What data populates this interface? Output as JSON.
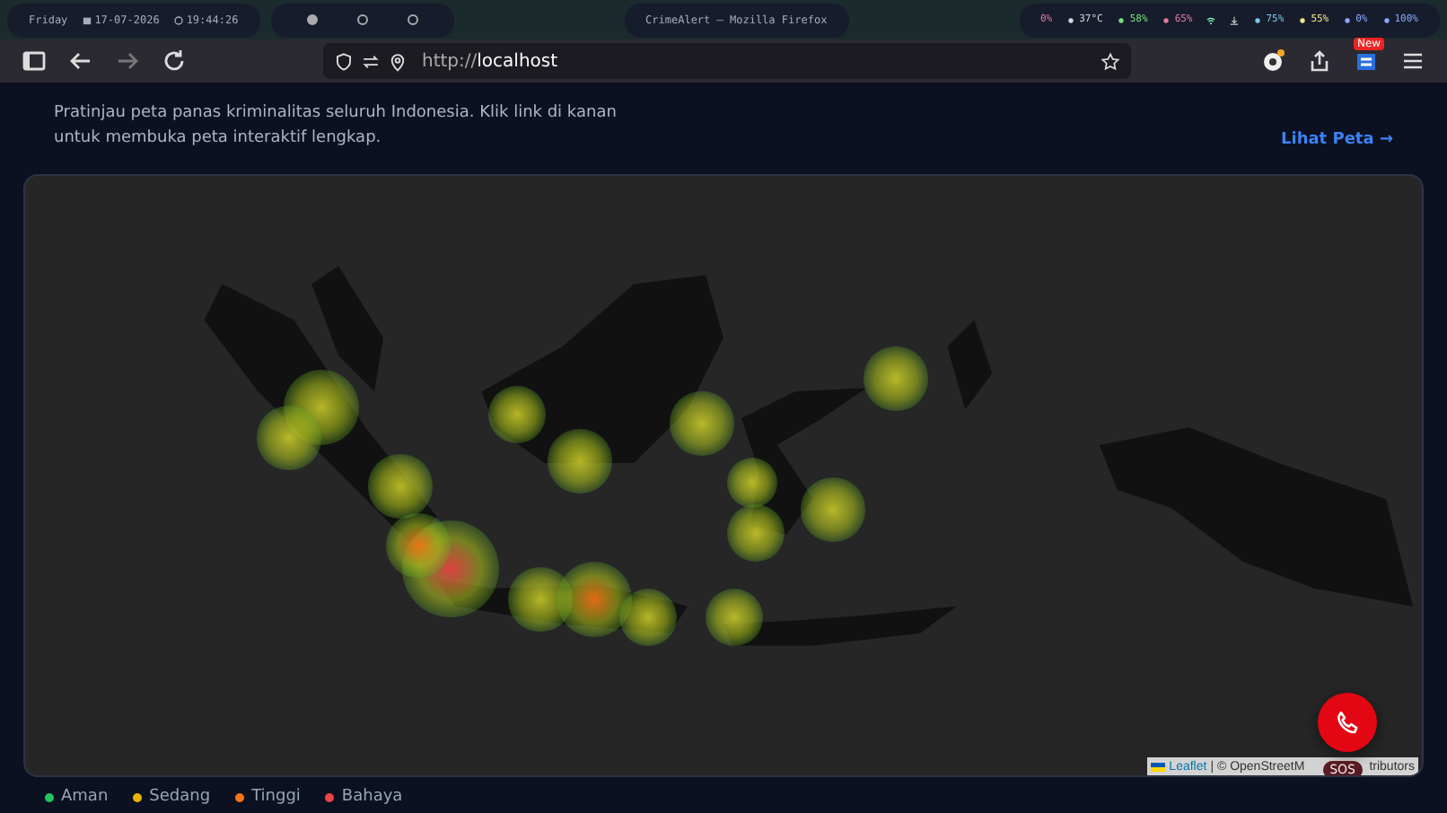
{
  "system_bar": {
    "day": "Friday",
    "date": "17-07-2026",
    "time": "19:44:26",
    "window_title": "CrimeAlert — Mozilla Firefox",
    "stats": [
      {
        "kind": "cpu",
        "value": "0%"
      },
      {
        "kind": "temp",
        "value": "37°C"
      },
      {
        "kind": "memory",
        "value": "58%"
      },
      {
        "kind": "disk",
        "value": "65%"
      },
      {
        "kind": "wifi"
      },
      {
        "kind": "download"
      },
      {
        "kind": "battery",
        "value": "75%"
      },
      {
        "kind": "brightness",
        "value": "55%"
      },
      {
        "kind": "volume",
        "value": "0%"
      },
      {
        "kind": "mic",
        "value": "100%"
      }
    ]
  },
  "browser": {
    "url_prefix": "http://",
    "url_host": "localhost",
    "badge": "New"
  },
  "section": {
    "description": "Pratinjau peta panas kriminalitas seluruh Indonesia. Klik link di kanan untuk membuka peta interaktif lengkap.",
    "link": "Lihat Peta →"
  },
  "map": {
    "attribution": {
      "link": "Leaflet",
      "before": "| © OpenStreetM",
      "after": "tributors"
    }
  },
  "sos": {
    "label": "SOS"
  },
  "legend": [
    {
      "label": "Aman",
      "color": "#22c55e"
    },
    {
      "label": "Sedang",
      "color": "#eab308"
    },
    {
      "label": "Tinggi",
      "color": "#f97316"
    },
    {
      "label": "Bahaya",
      "color": "#ef4444"
    }
  ]
}
